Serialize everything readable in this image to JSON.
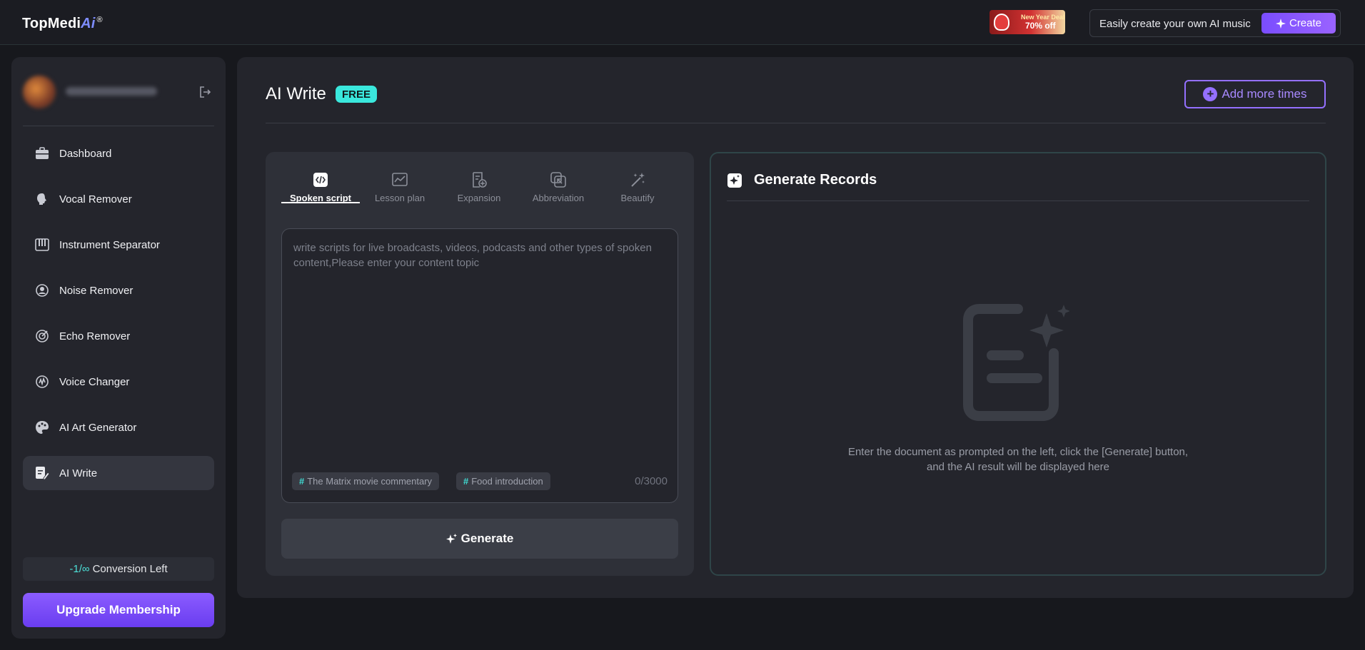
{
  "header": {
    "logo_main": "TopMedi",
    "logo_ai": "Ai",
    "logo_reg": "®",
    "promo_line1": "New Year Deals",
    "promo_line2": "70% off",
    "music_text": "Easily create your own AI music",
    "create_label": "Create"
  },
  "sidebar": {
    "logout_icon": "logout-icon",
    "items": [
      {
        "label": "Dashboard",
        "icon": "briefcase-icon"
      },
      {
        "label": "Vocal Remover",
        "icon": "vocal-icon"
      },
      {
        "label": "Instrument Separator",
        "icon": "piano-icon"
      },
      {
        "label": "Noise Remover",
        "icon": "noise-icon"
      },
      {
        "label": "Echo Remover",
        "icon": "echo-icon"
      },
      {
        "label": "Voice Changer",
        "icon": "voice-changer-icon"
      },
      {
        "label": "AI Art Generator",
        "icon": "palette-icon"
      },
      {
        "label": "AI Write",
        "icon": "write-icon",
        "active": true
      }
    ],
    "conversion_count": "-1/∞",
    "conversion_label": "Conversion Left",
    "upgrade_label": "Upgrade Membership"
  },
  "main": {
    "title": "AI Write",
    "badge": "FREE",
    "add_more_label": "Add more times",
    "tabs": [
      {
        "label": "Spoken script",
        "icon": "code-icon",
        "active": true
      },
      {
        "label": "Lesson plan",
        "icon": "chart-icon"
      },
      {
        "label": "Expansion",
        "icon": "doc-plus-icon"
      },
      {
        "label": "Abbreviation",
        "icon": "shrink-icon"
      },
      {
        "label": "Beautify",
        "icon": "magic-wand-icon"
      }
    ],
    "input_placeholder": "write scripts for live broadcasts, videos, podcasts and other types of spoken content,Please enter your content topic",
    "input_value": "",
    "chips": [
      "The Matrix movie commentary",
      "Food introduction"
    ],
    "chip_hash": "#",
    "counter": "0/3000",
    "generate_label": "Generate"
  },
  "records": {
    "title": "Generate Records",
    "empty_line1": "Enter the document as prompted on the left, click the [Generate] button,",
    "empty_line2": "and the AI result will be displayed here"
  },
  "colors": {
    "accent_purple": "#8b5cff",
    "accent_teal": "#3ae8dd",
    "background": "#17181d",
    "panel": "#24252c"
  }
}
